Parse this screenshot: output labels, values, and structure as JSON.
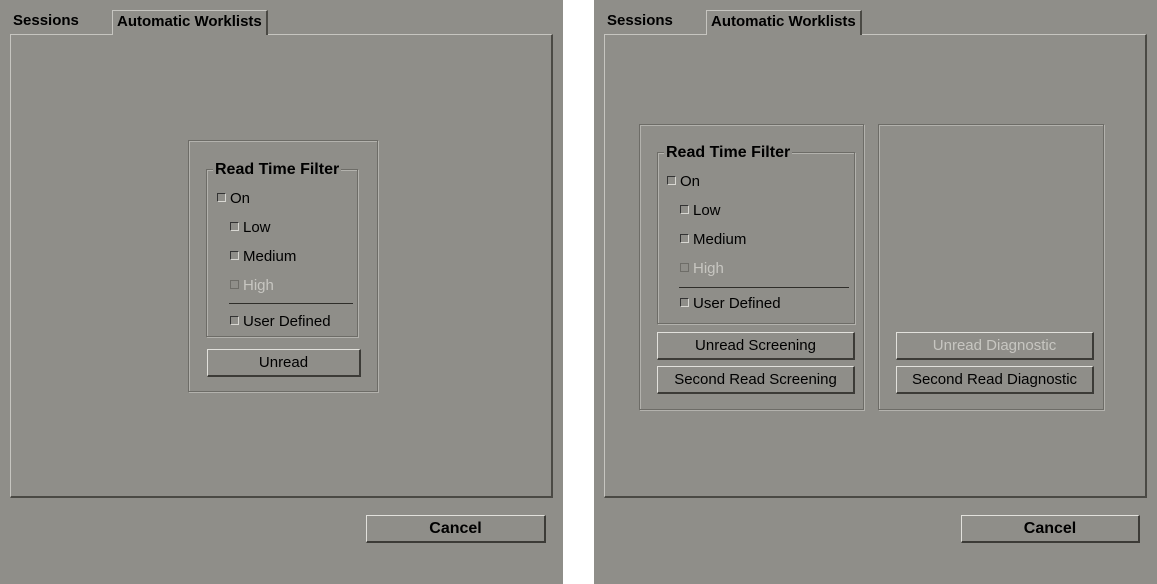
{
  "left_dialog": {
    "tabs": [
      {
        "label": "Sessions"
      },
      {
        "label": "Automatic Worklists"
      }
    ],
    "read_time_filter": {
      "title": "Read Time Filter",
      "on_label": "On",
      "low_label": "Low",
      "medium_label": "Medium",
      "high_label": "High",
      "user_defined_label": "User Defined"
    },
    "unread_button": "Unread",
    "cancel_button": "Cancel"
  },
  "right_dialog": {
    "tabs": [
      {
        "label": "Sessions"
      },
      {
        "label": "Automatic Worklists"
      }
    ],
    "read_time_filter": {
      "title": "Read Time Filter",
      "on_label": "On",
      "low_label": "Low",
      "medium_label": "Medium",
      "high_label": "High",
      "user_defined_label": "User Defined"
    },
    "unread_screening_button": "Unread Screening",
    "second_read_screening_button": "Second Read Screening",
    "unread_diagnostic_button": "Unread Diagnostic",
    "second_read_diagnostic_button": "Second Read Diagnostic",
    "cancel_button": "Cancel"
  },
  "colors": {
    "background": "#8f8e89",
    "disabled_text": "#c7c6c1"
  }
}
